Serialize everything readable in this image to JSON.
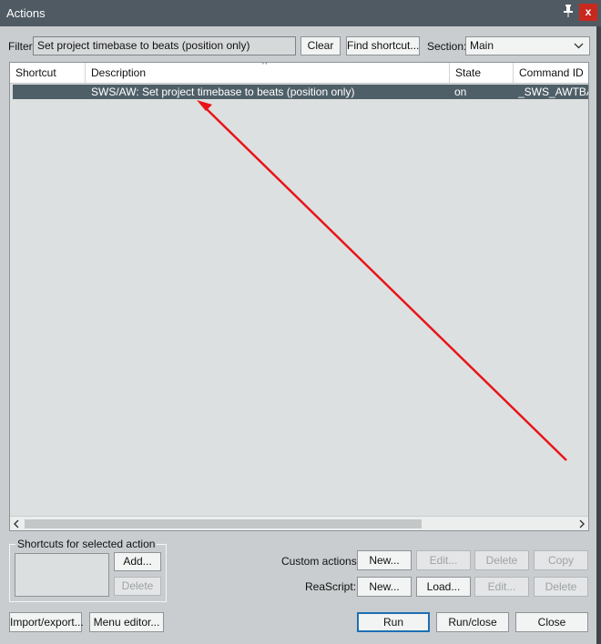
{
  "window": {
    "title": "Actions",
    "close_label": "x",
    "pin_label": "📌"
  },
  "filter": {
    "label": "Filter:",
    "value": "Set project timebase to beats (position only)"
  },
  "buttons": {
    "clear": "Clear",
    "find_shortcut": "Find shortcut..."
  },
  "section": {
    "label": "Section:",
    "value": "Main"
  },
  "table": {
    "headers": {
      "shortcut": "Shortcut",
      "description": "Description",
      "state": "State",
      "command_id": "Command ID"
    },
    "rows": [
      {
        "shortcut": "",
        "description": "SWS/AW: Set project timebase to beats (position only)",
        "state": "on",
        "command_id": "_SWS_AWTBA"
      }
    ]
  },
  "shortcuts_group": {
    "title": "Shortcuts for selected action",
    "add": "Add...",
    "delete": "Delete"
  },
  "custom_actions": {
    "label": "Custom actions:",
    "new": "New...",
    "edit": "Edit...",
    "delete": "Delete",
    "copy": "Copy"
  },
  "reascript": {
    "label": "ReaScript:",
    "new": "New...",
    "load": "Load...",
    "edit": "Edit...",
    "delete": "Delete"
  },
  "bottom": {
    "import_export": "Import/export...",
    "menu_editor": "Menu editor...",
    "run": "Run",
    "run_close": "Run/close",
    "close": "Close"
  },
  "colors": {
    "titlebar": "#4f5a63",
    "selection": "#4f5f68",
    "close": "#c8281e",
    "annotation_arrow": "#e8141a"
  }
}
